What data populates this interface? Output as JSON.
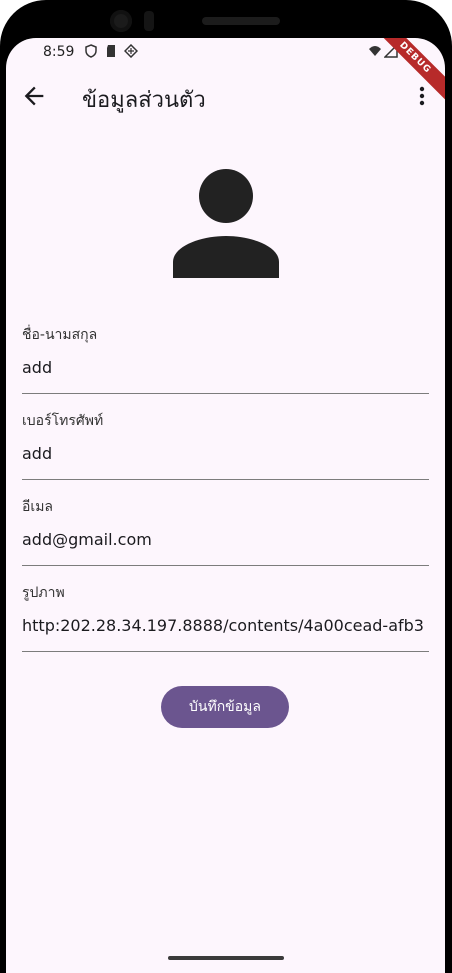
{
  "status": {
    "time": "8:59",
    "debug_label": "DEBUG"
  },
  "appbar": {
    "title": "ข้อมูลส่วนตัว"
  },
  "fields": [
    {
      "label": "ชื่อ-นามสกุล",
      "value": "add"
    },
    {
      "label": "เบอร์โทรศัพท์",
      "value": "add"
    },
    {
      "label": "อีเมล",
      "value": "add@gmail.com"
    },
    {
      "label": "รูปภาพ",
      "value": "http:202.28.34.197.8888/contents/4a00cead-afb3"
    }
  ],
  "actions": {
    "save_label": "บันทึกข้อมูล"
  },
  "colors": {
    "background": "#fdf6fd",
    "primary": "#6b558f"
  }
}
